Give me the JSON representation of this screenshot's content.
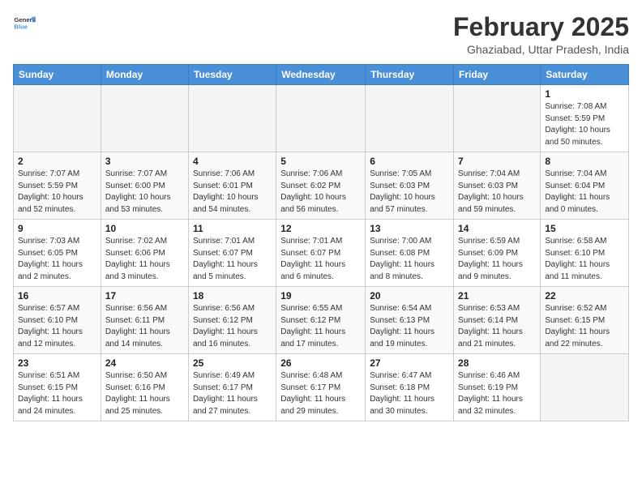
{
  "header": {
    "logo": {
      "general": "General",
      "blue": "Blue"
    },
    "title": "February 2025",
    "subtitle": "Ghaziabad, Uttar Pradesh, India"
  },
  "weekdays": [
    "Sunday",
    "Monday",
    "Tuesday",
    "Wednesday",
    "Thursday",
    "Friday",
    "Saturday"
  ],
  "weeks": [
    [
      {
        "day": null,
        "sunrise": null,
        "sunset": null,
        "daylight": null
      },
      {
        "day": null,
        "sunrise": null,
        "sunset": null,
        "daylight": null
      },
      {
        "day": null,
        "sunrise": null,
        "sunset": null,
        "daylight": null
      },
      {
        "day": null,
        "sunrise": null,
        "sunset": null,
        "daylight": null
      },
      {
        "day": null,
        "sunrise": null,
        "sunset": null,
        "daylight": null
      },
      {
        "day": null,
        "sunrise": null,
        "sunset": null,
        "daylight": null
      },
      {
        "day": "1",
        "sunrise": "7:08 AM",
        "sunset": "5:59 PM",
        "daylight": "10 hours and 50 minutes."
      }
    ],
    [
      {
        "day": "2",
        "sunrise": "7:07 AM",
        "sunset": "5:59 PM",
        "daylight": "10 hours and 52 minutes."
      },
      {
        "day": "3",
        "sunrise": "7:07 AM",
        "sunset": "6:00 PM",
        "daylight": "10 hours and 53 minutes."
      },
      {
        "day": "4",
        "sunrise": "7:06 AM",
        "sunset": "6:01 PM",
        "daylight": "10 hours and 54 minutes."
      },
      {
        "day": "5",
        "sunrise": "7:06 AM",
        "sunset": "6:02 PM",
        "daylight": "10 hours and 56 minutes."
      },
      {
        "day": "6",
        "sunrise": "7:05 AM",
        "sunset": "6:03 PM",
        "daylight": "10 hours and 57 minutes."
      },
      {
        "day": "7",
        "sunrise": "7:04 AM",
        "sunset": "6:03 PM",
        "daylight": "10 hours and 59 minutes."
      },
      {
        "day": "8",
        "sunrise": "7:04 AM",
        "sunset": "6:04 PM",
        "daylight": "11 hours and 0 minutes."
      }
    ],
    [
      {
        "day": "9",
        "sunrise": "7:03 AM",
        "sunset": "6:05 PM",
        "daylight": "11 hours and 2 minutes."
      },
      {
        "day": "10",
        "sunrise": "7:02 AM",
        "sunset": "6:06 PM",
        "daylight": "11 hours and 3 minutes."
      },
      {
        "day": "11",
        "sunrise": "7:01 AM",
        "sunset": "6:07 PM",
        "daylight": "11 hours and 5 minutes."
      },
      {
        "day": "12",
        "sunrise": "7:01 AM",
        "sunset": "6:07 PM",
        "daylight": "11 hours and 6 minutes."
      },
      {
        "day": "13",
        "sunrise": "7:00 AM",
        "sunset": "6:08 PM",
        "daylight": "11 hours and 8 minutes."
      },
      {
        "day": "14",
        "sunrise": "6:59 AM",
        "sunset": "6:09 PM",
        "daylight": "11 hours and 9 minutes."
      },
      {
        "day": "15",
        "sunrise": "6:58 AM",
        "sunset": "6:10 PM",
        "daylight": "11 hours and 11 minutes."
      }
    ],
    [
      {
        "day": "16",
        "sunrise": "6:57 AM",
        "sunset": "6:10 PM",
        "daylight": "11 hours and 12 minutes."
      },
      {
        "day": "17",
        "sunrise": "6:56 AM",
        "sunset": "6:11 PM",
        "daylight": "11 hours and 14 minutes."
      },
      {
        "day": "18",
        "sunrise": "6:56 AM",
        "sunset": "6:12 PM",
        "daylight": "11 hours and 16 minutes."
      },
      {
        "day": "19",
        "sunrise": "6:55 AM",
        "sunset": "6:12 PM",
        "daylight": "11 hours and 17 minutes."
      },
      {
        "day": "20",
        "sunrise": "6:54 AM",
        "sunset": "6:13 PM",
        "daylight": "11 hours and 19 minutes."
      },
      {
        "day": "21",
        "sunrise": "6:53 AM",
        "sunset": "6:14 PM",
        "daylight": "11 hours and 21 minutes."
      },
      {
        "day": "22",
        "sunrise": "6:52 AM",
        "sunset": "6:15 PM",
        "daylight": "11 hours and 22 minutes."
      }
    ],
    [
      {
        "day": "23",
        "sunrise": "6:51 AM",
        "sunset": "6:15 PM",
        "daylight": "11 hours and 24 minutes."
      },
      {
        "day": "24",
        "sunrise": "6:50 AM",
        "sunset": "6:16 PM",
        "daylight": "11 hours and 25 minutes."
      },
      {
        "day": "25",
        "sunrise": "6:49 AM",
        "sunset": "6:17 PM",
        "daylight": "11 hours and 27 minutes."
      },
      {
        "day": "26",
        "sunrise": "6:48 AM",
        "sunset": "6:17 PM",
        "daylight": "11 hours and 29 minutes."
      },
      {
        "day": "27",
        "sunrise": "6:47 AM",
        "sunset": "6:18 PM",
        "daylight": "11 hours and 30 minutes."
      },
      {
        "day": "28",
        "sunrise": "6:46 AM",
        "sunset": "6:19 PM",
        "daylight": "11 hours and 32 minutes."
      },
      {
        "day": null,
        "sunrise": null,
        "sunset": null,
        "daylight": null
      }
    ]
  ]
}
